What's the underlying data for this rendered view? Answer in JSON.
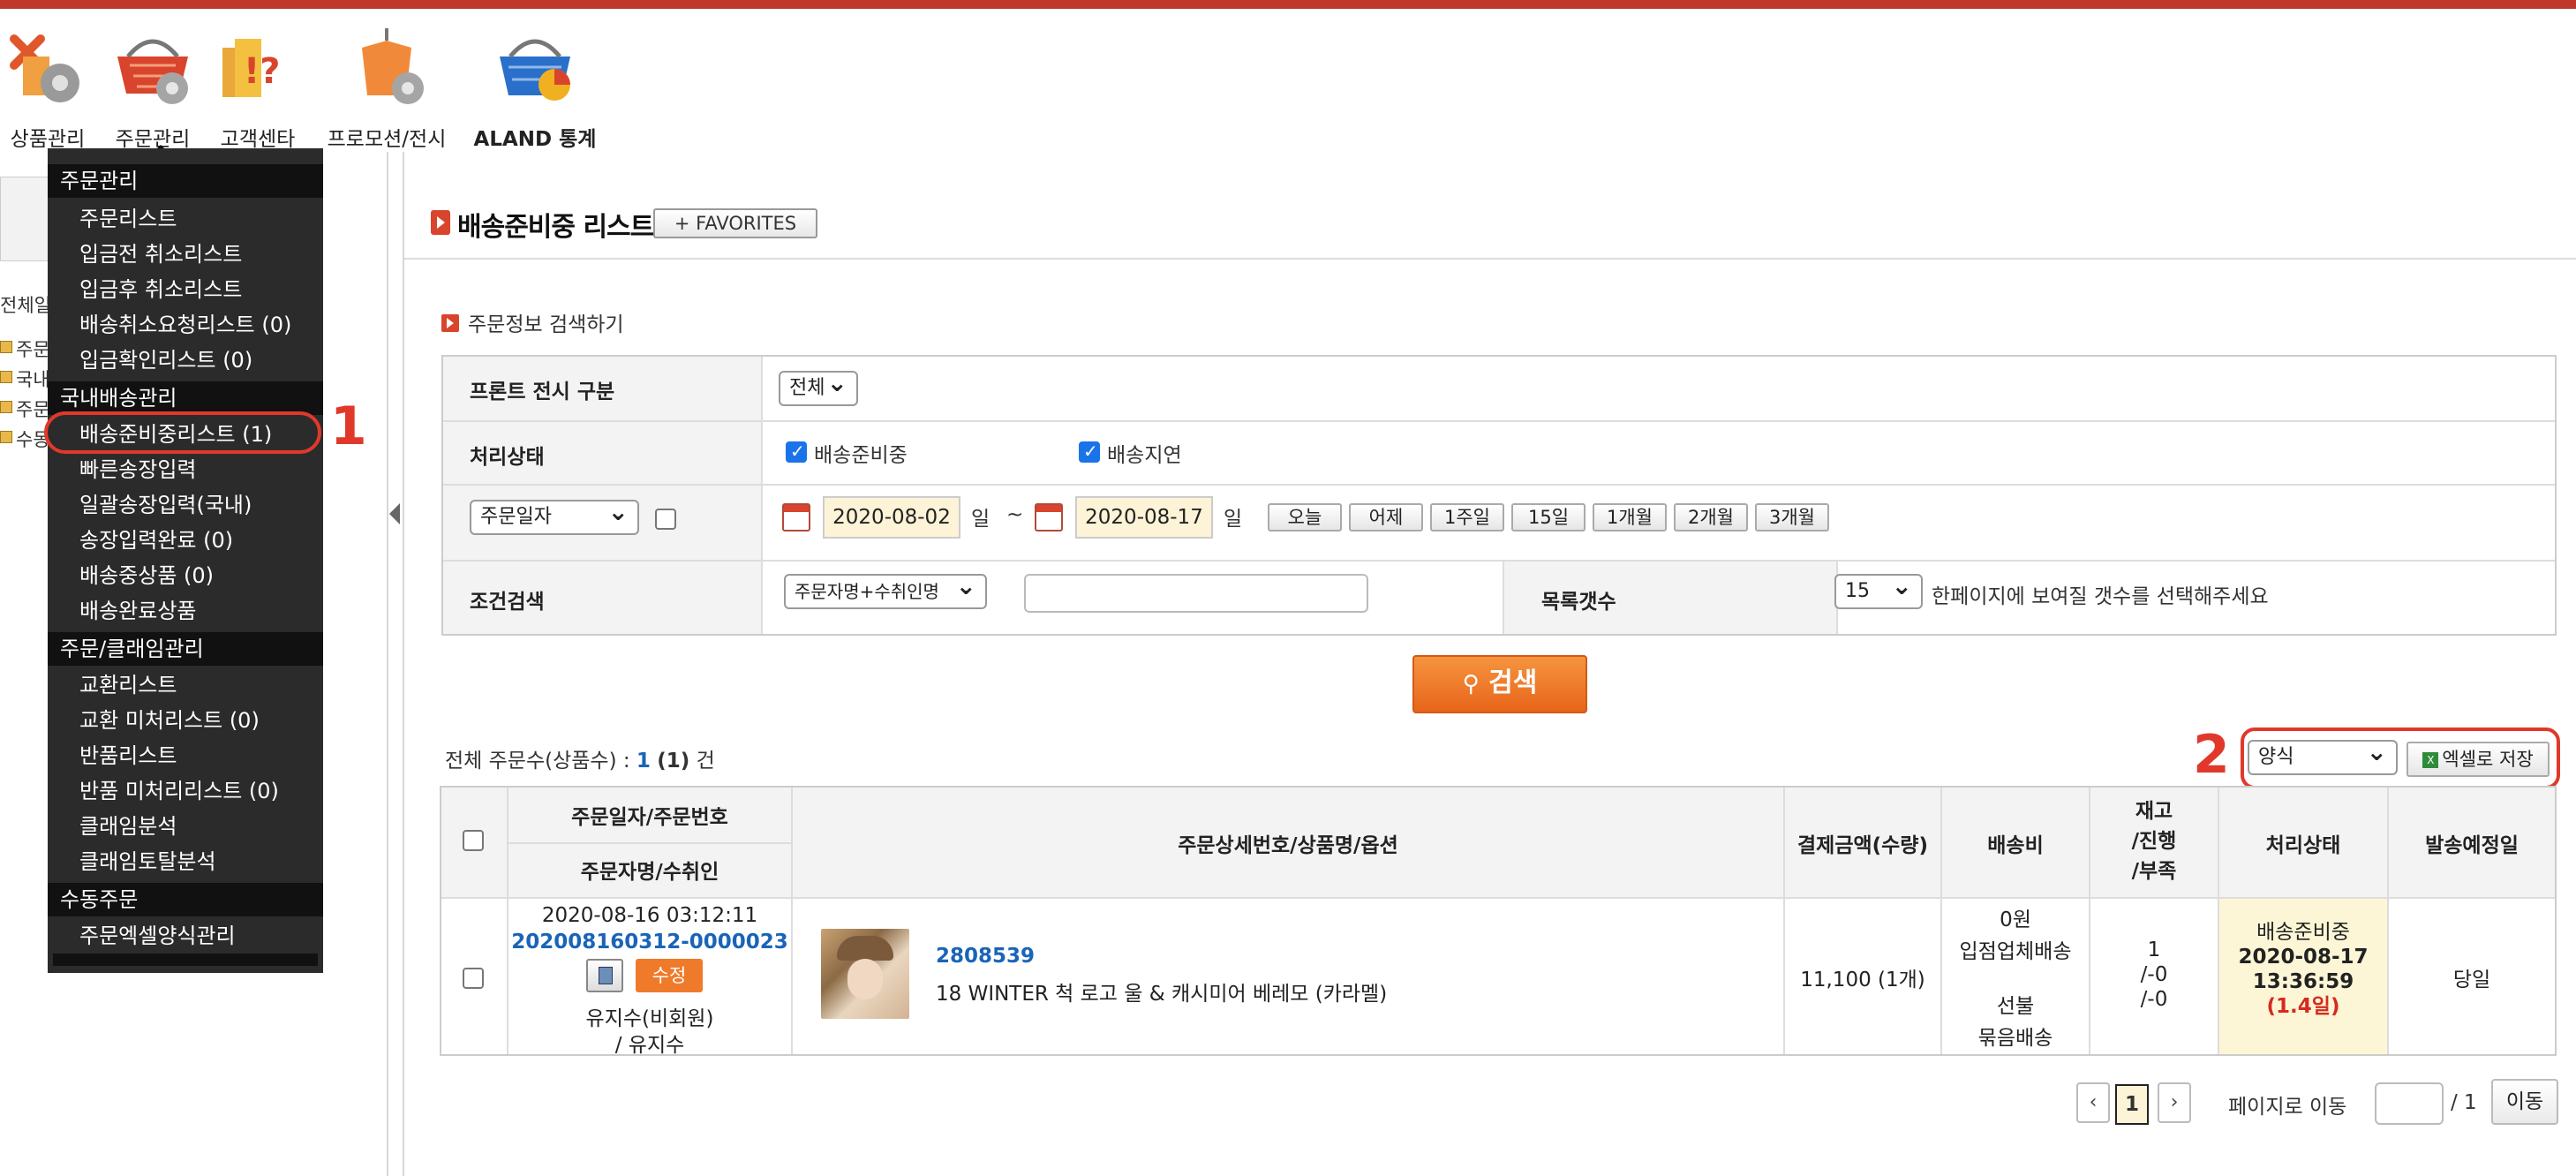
{
  "nav": {
    "items": [
      {
        "label": "상품관리",
        "icon": "product-management-icon"
      },
      {
        "label": "주문관리",
        "icon": "order-management-icon"
      },
      {
        "label": "고객센타",
        "icon": "customer-center-icon"
      },
      {
        "label": "프로모션/전시",
        "icon": "promotion-icon"
      },
      {
        "label": "ALAND 통계",
        "icon": "statistics-icon"
      }
    ]
  },
  "left_panel": {
    "header": "전체일",
    "tree": [
      "주문",
      "국내",
      "주문",
      "수동"
    ]
  },
  "menu": {
    "sections": [
      {
        "title": "주문관리",
        "items": [
          "주문리스트",
          "입금전 취소리스트",
          "입금후 취소리스트",
          "배송취소요청리스트 (0)",
          "입금확인리스트 (0)"
        ]
      },
      {
        "title": "국내배송관리",
        "items": [
          "배송준비중리스트 (1)",
          "빠른송장입력",
          "일괄송장입력(국내)",
          "송장입력완료 (0)",
          "배송중상품 (0)",
          "배송완료상품"
        ]
      },
      {
        "title": "주문/클래임관리",
        "items": [
          "교환리스트",
          "교환 미처리스트 (0)",
          "반품리스트",
          "반품 미처리리스트 (0)",
          "클래임분석",
          "클래임토탈분석"
        ]
      },
      {
        "title": "수동주문",
        "items": [
          "주문엑셀양식관리"
        ]
      }
    ],
    "annotation_1": "1"
  },
  "page": {
    "title": "배송준비중 리스트",
    "favorites": "+ FAVORITES"
  },
  "search": {
    "section_title": "주문정보 검색하기",
    "front_label": "프론트 전시 구분",
    "front_value": "전체",
    "status_label": "처리상태",
    "status_options": [
      {
        "label": "배송준비중",
        "checked": true
      },
      {
        "label": "배송지연",
        "checked": true
      }
    ],
    "date_type": "주문일자",
    "date_from": "2020-08-02",
    "date_to": "2020-08-17",
    "day_unit": "일",
    "tilde": "~",
    "quick_ranges": [
      "오늘",
      "어제",
      "1주일",
      "15일",
      "1개월",
      "2개월",
      "3개월"
    ],
    "cond_label": "조건검색",
    "cond_type": "주문자명+수취인명",
    "list_count_label": "목록갯수",
    "list_count": "15",
    "list_count_help": "한페이지에 보여질 갯수를 선택해주세요",
    "search_button": "검색"
  },
  "results": {
    "total_prefix": "전체 주문수(상품수) : ",
    "total_orders": "1",
    "total_items": "(1)",
    "total_suffix": " 건",
    "annotation_2": "2",
    "format_select": "양식",
    "excel_button": "엑셀로 저장",
    "headers": {
      "order_date_no": "주문일자/주문번호",
      "orderer_receiver": "주문자명/수취인",
      "detail": "주문상세번호/상품명/옵션",
      "payment": "결제금액(수량)",
      "shipping": "배송비",
      "stock_line1": "재고",
      "stock_line2": "/진행",
      "stock_line3": "/부족",
      "status": "처리상태",
      "ship_date": "발송예정일"
    },
    "rows": [
      {
        "order_datetime": "2020-08-16 03:12:11",
        "order_no": "202008160312-0000023",
        "edit_button": "수정",
        "orderer": "유지수(비회원)",
        "receiver": "/ 유지수",
        "detail_no": "2808539",
        "product_name": "18 WINTER 척 로고 울 & 캐시미어 베레모 (카라멜)",
        "payment": "11,100 (1개)",
        "shipping_fee": "0원",
        "shipping_type": "입점업체배송",
        "shipping_pay": "선불",
        "shipping_bundle": "묶음배송",
        "stock": "1",
        "progress": "/-0",
        "shortage": "/-0",
        "status": "배송준비중",
        "status_date": "2020-08-17",
        "status_time": "13:36:59",
        "status_elapsed": "(1.4일)",
        "ship_date": "당일"
      }
    ]
  },
  "pagination": {
    "prev": "‹",
    "current": "1",
    "next": "›",
    "goto_label": "페이지로 이동",
    "total": "/ 1",
    "go_button": "이동"
  },
  "colors": {
    "accent_red": "#e0392b",
    "menu_bg": "#2b2b2b",
    "search_button": "#ef7a2a",
    "link_blue": "#1a64b8"
  }
}
